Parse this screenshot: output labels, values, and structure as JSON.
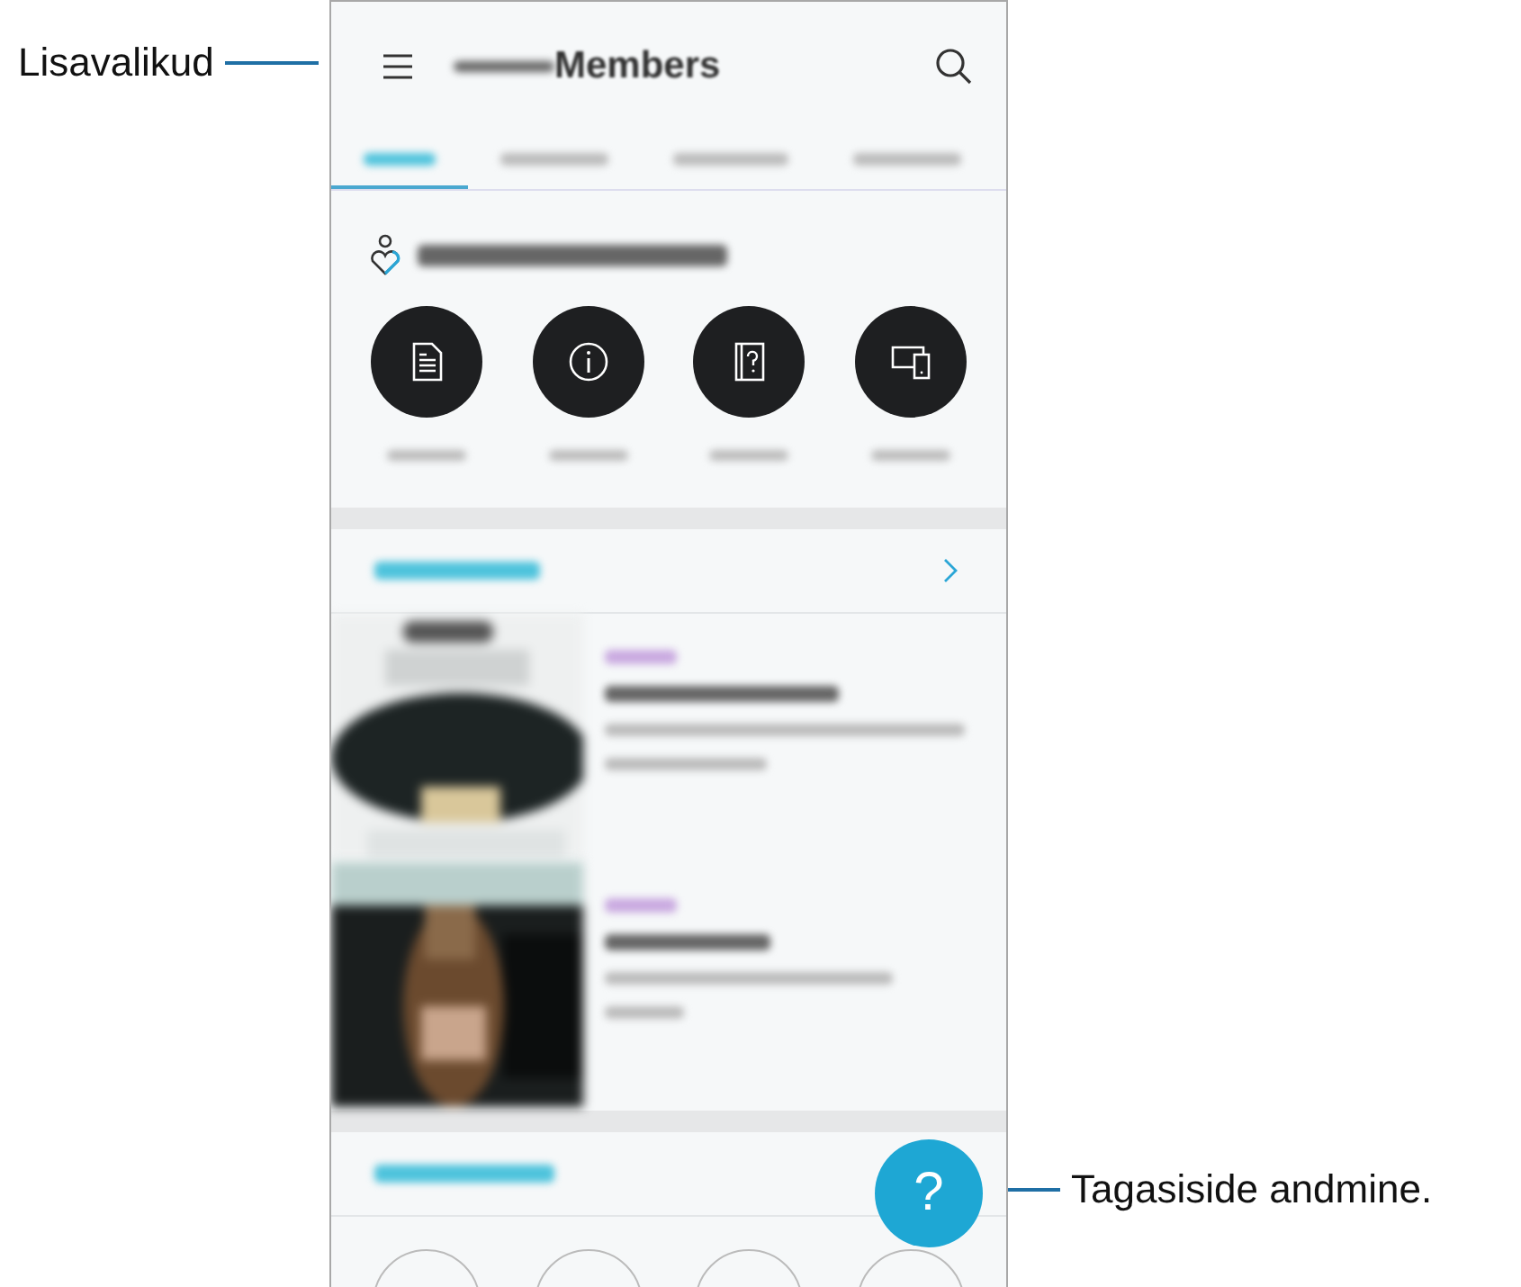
{
  "menu_callout": {
    "label": "Lisavalikud"
  },
  "fab_callout": {
    "label": "Tagasiside andmine."
  },
  "app_bar": {
    "title": "Members"
  },
  "tabs": [
    {
      "selected": true
    },
    {
      "selected": false
    },
    {
      "selected": false
    },
    {
      "selected": false
    }
  ],
  "fab": {
    "label": "?"
  }
}
